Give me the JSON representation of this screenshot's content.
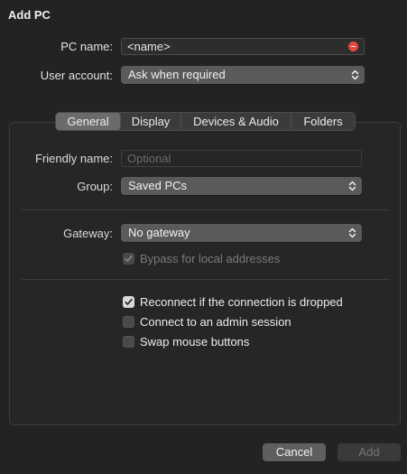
{
  "window": {
    "title": "Add PC"
  },
  "pc_name": {
    "label": "PC name:",
    "value": "<name>"
  },
  "user_account": {
    "label": "User account:",
    "value": "Ask when required"
  },
  "tabs": [
    {
      "label": "General",
      "active": true
    },
    {
      "label": "Display",
      "active": false
    },
    {
      "label": "Devices & Audio",
      "active": false
    },
    {
      "label": "Folders",
      "active": false
    }
  ],
  "general": {
    "friendly_name": {
      "label": "Friendly name:",
      "placeholder": "Optional"
    },
    "group": {
      "label": "Group:",
      "value": "Saved PCs"
    },
    "gateway": {
      "label": "Gateway:",
      "value": "No gateway"
    },
    "bypass": {
      "label": "Bypass for local addresses",
      "checked": true,
      "enabled": false
    },
    "reconnect": {
      "label": "Reconnect if the connection is dropped",
      "checked": true
    },
    "admin_session": {
      "label": "Connect to an admin session",
      "checked": false
    },
    "swap_mouse": {
      "label": "Swap mouse buttons",
      "checked": false
    }
  },
  "buttons": {
    "cancel": "Cancel",
    "add": "Add"
  },
  "icons": {
    "clear": "clear-field-icon",
    "popup": "chevron-up-down-icon",
    "check": "checkmark-icon"
  },
  "colors": {
    "clear": "#e5483f",
    "background": "#232323"
  }
}
